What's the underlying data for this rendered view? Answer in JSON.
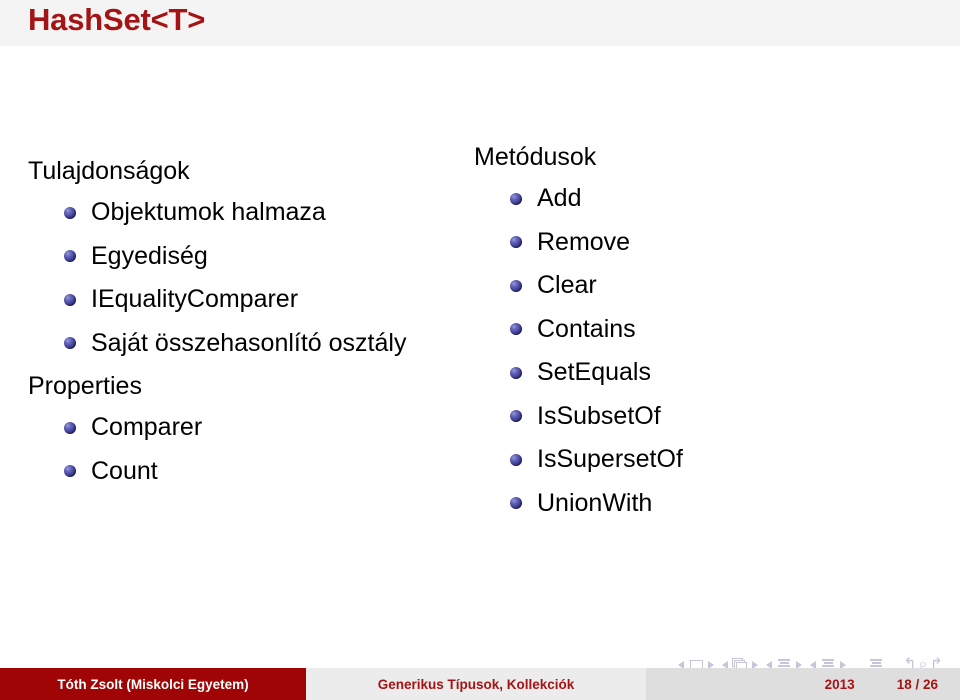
{
  "slide": {
    "title": "HashSet<T>",
    "title_color": "#a51414",
    "background_color": "#ffffff",
    "title_band_color": "#f4f4f4",
    "bullet_color": "#3f3f96"
  },
  "columns": {
    "left": {
      "blocks": [
        {
          "heading": "Tulajdonságok",
          "items": [
            "Objektumok halmaza",
            "Egyediség",
            "IEqualityComparer",
            "Saját összehasonlító osztály"
          ]
        },
        {
          "heading": "Properties",
          "items": [
            "Comparer",
            "Count"
          ]
        }
      ]
    },
    "right": {
      "blocks": [
        {
          "heading": "Metódusok",
          "items": [
            "Add",
            "Remove",
            "Clear",
            "Contains",
            "SetEquals",
            "IsSubsetOf",
            "IsSupersetOf",
            "UnionWith"
          ]
        }
      ]
    }
  },
  "navigation": {
    "icons": [
      "previous-slide-icon",
      "slide-icon",
      "next-slide-icon",
      "previous-frame-icon",
      "frame-icon",
      "next-frame-icon",
      "previous-subsection-icon",
      "subsection-icon",
      "next-subsection-icon",
      "previous-section-icon",
      "section-icon",
      "next-section-icon",
      "presentation-icon",
      "back-icon",
      "find-icon",
      "forward-icon"
    ],
    "back_glyph": "↰",
    "find_glyph": "⌕",
    "forward_glyph": "↱"
  },
  "footer": {
    "author": "Tóth Zsolt  (Miskolci Egyetem)",
    "topic": "Generikus Típusok, Kollekciók",
    "year": "2013",
    "page": "18 / 26",
    "author_bg": "#a00505",
    "topic_bg": "#ececec",
    "meta_bg": "#dedede"
  }
}
